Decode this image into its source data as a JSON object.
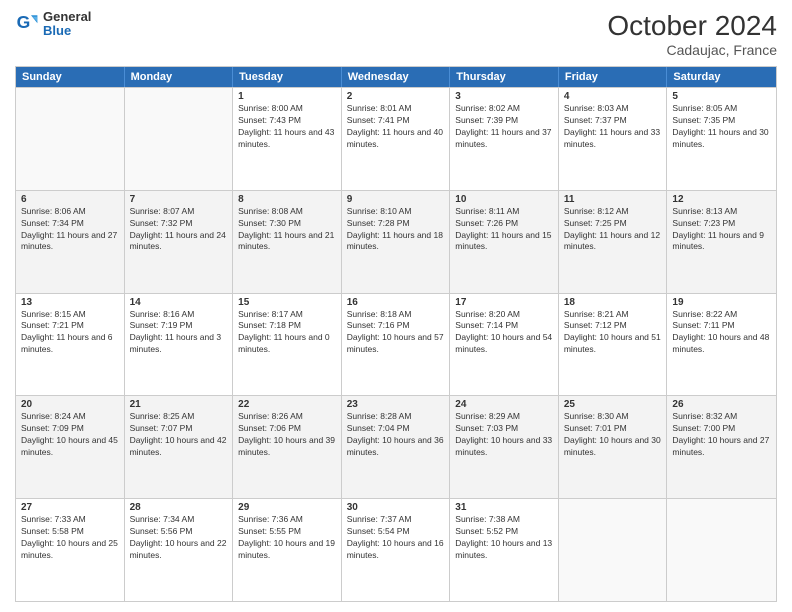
{
  "header": {
    "logo_line1": "General",
    "logo_line2": "Blue",
    "month": "October 2024",
    "location": "Cadaujac, France"
  },
  "weekdays": [
    "Sunday",
    "Monday",
    "Tuesday",
    "Wednesday",
    "Thursday",
    "Friday",
    "Saturday"
  ],
  "rows": [
    [
      {
        "day": "",
        "sunrise": "",
        "sunset": "",
        "daylight": "",
        "empty": true
      },
      {
        "day": "",
        "sunrise": "",
        "sunset": "",
        "daylight": "",
        "empty": true
      },
      {
        "day": "1",
        "sunrise": "Sunrise: 8:00 AM",
        "sunset": "Sunset: 7:43 PM",
        "daylight": "Daylight: 11 hours and 43 minutes."
      },
      {
        "day": "2",
        "sunrise": "Sunrise: 8:01 AM",
        "sunset": "Sunset: 7:41 PM",
        "daylight": "Daylight: 11 hours and 40 minutes."
      },
      {
        "day": "3",
        "sunrise": "Sunrise: 8:02 AM",
        "sunset": "Sunset: 7:39 PM",
        "daylight": "Daylight: 11 hours and 37 minutes."
      },
      {
        "day": "4",
        "sunrise": "Sunrise: 8:03 AM",
        "sunset": "Sunset: 7:37 PM",
        "daylight": "Daylight: 11 hours and 33 minutes."
      },
      {
        "day": "5",
        "sunrise": "Sunrise: 8:05 AM",
        "sunset": "Sunset: 7:35 PM",
        "daylight": "Daylight: 11 hours and 30 minutes."
      }
    ],
    [
      {
        "day": "6",
        "sunrise": "Sunrise: 8:06 AM",
        "sunset": "Sunset: 7:34 PM",
        "daylight": "Daylight: 11 hours and 27 minutes."
      },
      {
        "day": "7",
        "sunrise": "Sunrise: 8:07 AM",
        "sunset": "Sunset: 7:32 PM",
        "daylight": "Daylight: 11 hours and 24 minutes."
      },
      {
        "day": "8",
        "sunrise": "Sunrise: 8:08 AM",
        "sunset": "Sunset: 7:30 PM",
        "daylight": "Daylight: 11 hours and 21 minutes."
      },
      {
        "day": "9",
        "sunrise": "Sunrise: 8:10 AM",
        "sunset": "Sunset: 7:28 PM",
        "daylight": "Daylight: 11 hours and 18 minutes."
      },
      {
        "day": "10",
        "sunrise": "Sunrise: 8:11 AM",
        "sunset": "Sunset: 7:26 PM",
        "daylight": "Daylight: 11 hours and 15 minutes."
      },
      {
        "day": "11",
        "sunrise": "Sunrise: 8:12 AM",
        "sunset": "Sunset: 7:25 PM",
        "daylight": "Daylight: 11 hours and 12 minutes."
      },
      {
        "day": "12",
        "sunrise": "Sunrise: 8:13 AM",
        "sunset": "Sunset: 7:23 PM",
        "daylight": "Daylight: 11 hours and 9 minutes."
      }
    ],
    [
      {
        "day": "13",
        "sunrise": "Sunrise: 8:15 AM",
        "sunset": "Sunset: 7:21 PM",
        "daylight": "Daylight: 11 hours and 6 minutes."
      },
      {
        "day": "14",
        "sunrise": "Sunrise: 8:16 AM",
        "sunset": "Sunset: 7:19 PM",
        "daylight": "Daylight: 11 hours and 3 minutes."
      },
      {
        "day": "15",
        "sunrise": "Sunrise: 8:17 AM",
        "sunset": "Sunset: 7:18 PM",
        "daylight": "Daylight: 11 hours and 0 minutes."
      },
      {
        "day": "16",
        "sunrise": "Sunrise: 8:18 AM",
        "sunset": "Sunset: 7:16 PM",
        "daylight": "Daylight: 10 hours and 57 minutes."
      },
      {
        "day": "17",
        "sunrise": "Sunrise: 8:20 AM",
        "sunset": "Sunset: 7:14 PM",
        "daylight": "Daylight: 10 hours and 54 minutes."
      },
      {
        "day": "18",
        "sunrise": "Sunrise: 8:21 AM",
        "sunset": "Sunset: 7:12 PM",
        "daylight": "Daylight: 10 hours and 51 minutes."
      },
      {
        "day": "19",
        "sunrise": "Sunrise: 8:22 AM",
        "sunset": "Sunset: 7:11 PM",
        "daylight": "Daylight: 10 hours and 48 minutes."
      }
    ],
    [
      {
        "day": "20",
        "sunrise": "Sunrise: 8:24 AM",
        "sunset": "Sunset: 7:09 PM",
        "daylight": "Daylight: 10 hours and 45 minutes."
      },
      {
        "day": "21",
        "sunrise": "Sunrise: 8:25 AM",
        "sunset": "Sunset: 7:07 PM",
        "daylight": "Daylight: 10 hours and 42 minutes."
      },
      {
        "day": "22",
        "sunrise": "Sunrise: 8:26 AM",
        "sunset": "Sunset: 7:06 PM",
        "daylight": "Daylight: 10 hours and 39 minutes."
      },
      {
        "day": "23",
        "sunrise": "Sunrise: 8:28 AM",
        "sunset": "Sunset: 7:04 PM",
        "daylight": "Daylight: 10 hours and 36 minutes."
      },
      {
        "day": "24",
        "sunrise": "Sunrise: 8:29 AM",
        "sunset": "Sunset: 7:03 PM",
        "daylight": "Daylight: 10 hours and 33 minutes."
      },
      {
        "day": "25",
        "sunrise": "Sunrise: 8:30 AM",
        "sunset": "Sunset: 7:01 PM",
        "daylight": "Daylight: 10 hours and 30 minutes."
      },
      {
        "day": "26",
        "sunrise": "Sunrise: 8:32 AM",
        "sunset": "Sunset: 7:00 PM",
        "daylight": "Daylight: 10 hours and 27 minutes."
      }
    ],
    [
      {
        "day": "27",
        "sunrise": "Sunrise: 7:33 AM",
        "sunset": "Sunset: 5:58 PM",
        "daylight": "Daylight: 10 hours and 25 minutes."
      },
      {
        "day": "28",
        "sunrise": "Sunrise: 7:34 AM",
        "sunset": "Sunset: 5:56 PM",
        "daylight": "Daylight: 10 hours and 22 minutes."
      },
      {
        "day": "29",
        "sunrise": "Sunrise: 7:36 AM",
        "sunset": "Sunset: 5:55 PM",
        "daylight": "Daylight: 10 hours and 19 minutes."
      },
      {
        "day": "30",
        "sunrise": "Sunrise: 7:37 AM",
        "sunset": "Sunset: 5:54 PM",
        "daylight": "Daylight: 10 hours and 16 minutes."
      },
      {
        "day": "31",
        "sunrise": "Sunrise: 7:38 AM",
        "sunset": "Sunset: 5:52 PM",
        "daylight": "Daylight: 10 hours and 13 minutes."
      },
      {
        "day": "",
        "sunrise": "",
        "sunset": "",
        "daylight": "",
        "empty": true
      },
      {
        "day": "",
        "sunrise": "",
        "sunset": "",
        "daylight": "",
        "empty": true
      }
    ]
  ]
}
